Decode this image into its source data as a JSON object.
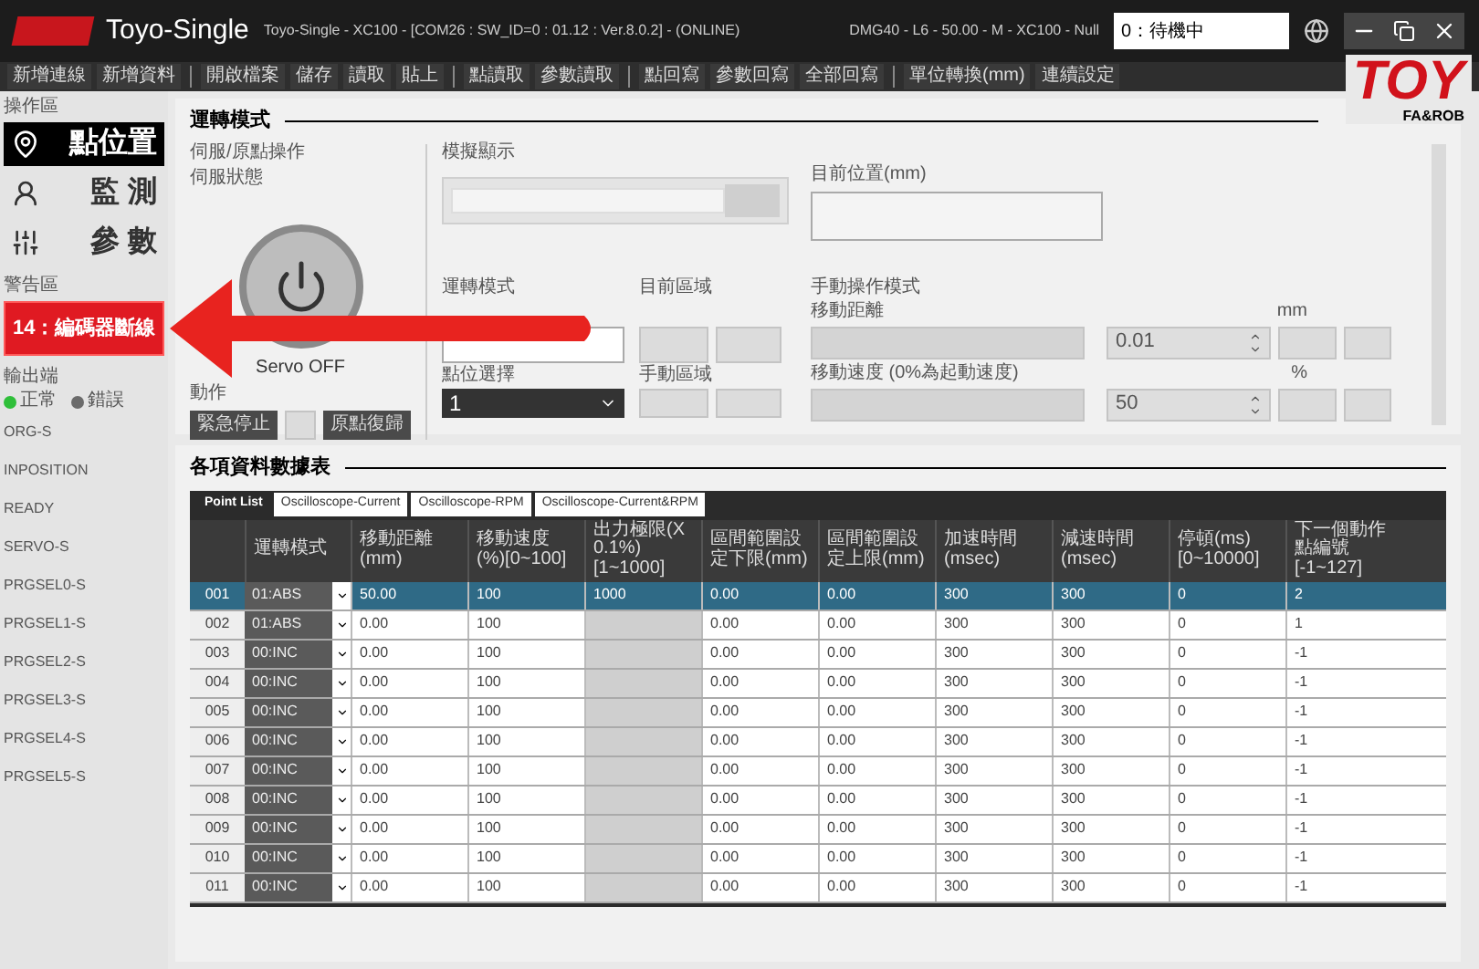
{
  "title_bar": {
    "app_name": "Toyo-Single",
    "info": "Toyo-Single - XC100 - [COM26 : SW_ID=0 : 01.12 : Ver.8.0.2] - (ONLINE)",
    "model": "DMG40 - L6 - 50.00 - M - XC100 - Null",
    "status": "0：待機中"
  },
  "toolbar": [
    [
      "新增連線",
      "新增資料"
    ],
    [
      "開啟檔案",
      "儲存",
      "讀取",
      "貼上"
    ],
    [
      "點讀取",
      "參數讀取"
    ],
    [
      "點回寫",
      "參數回寫",
      "全部回寫"
    ],
    [
      "單位轉換(mm)",
      "連續設定"
    ]
  ],
  "brand": {
    "name": "TOY",
    "tagline": "FA&ROB"
  },
  "sidebar": {
    "nav_label": "操作區",
    "nav": [
      {
        "label": "點位置",
        "selected": true
      },
      {
        "label": "監 測",
        "selected": false
      },
      {
        "label": "參 數",
        "selected": false
      }
    ],
    "alarm_label": "警告區",
    "alarm": "14：編碼器斷線",
    "io_label": "輸出端",
    "legend": [
      {
        "label": "正常",
        "color": "#2fbf3a"
      },
      {
        "label": "錯誤",
        "color": "#6b6b6b"
      }
    ],
    "signals": [
      "ORG-S",
      "INPOSITION",
      "READY",
      "SERVO-S",
      "PRGSEL0-S",
      "PRGSEL1-S",
      "PRGSEL2-S",
      "PRGSEL3-S",
      "PRGSEL4-S",
      "PRGSEL5-S"
    ]
  },
  "operation": {
    "title": "運轉模式",
    "servo_label": "伺服/原點操作",
    "servo_state_label": "伺服狀態",
    "servo_text": "Servo OFF",
    "action_label": "動作",
    "action_buttons": [
      "緊急停止",
      "原點復歸"
    ],
    "sim_label": "模擬顯示",
    "position_label": "目前位置(mm)",
    "mode_label": "運轉模式",
    "current_area_label": "目前區域",
    "point_label": "點位選擇",
    "point_value": "1",
    "manual_area_label": "手動區域",
    "manual_title": "手動操作模式",
    "distance_label": "移動距離",
    "distance_value": "0.01",
    "distance_unit": "mm",
    "speed_label": "移動速度 (0%為起動速度)",
    "speed_value": "50",
    "speed_unit": "%"
  },
  "data_table": {
    "title": "各項資料數據表",
    "tabs": [
      {
        "label": "Point List",
        "selected": true
      },
      {
        "label": "Oscilloscope-Current",
        "selected": false
      },
      {
        "label": "Oscilloscope-RPM",
        "selected": false
      },
      {
        "label": "Oscilloscope-Current&RPM",
        "selected": false
      }
    ],
    "columns": [
      "運轉模式",
      "移動距離(mm)",
      "移動速度(%)[0~100]",
      "出力極限(X 0.1%)[1~1000]",
      "區間範圍設定下限(mm)",
      "區間範圍設定上限(mm)",
      "加速時間(msec)",
      "減速時間(msec)",
      "停頓(ms)[0~10000]",
      "下一個動作點編號[-1~127]"
    ],
    "rows": [
      {
        "no": "001",
        "mode": "01:ABS",
        "distance": "50.00",
        "speed": "100",
        "force": "1000",
        "lower": "0.00",
        "upper": "0.00",
        "accel": "300",
        "decel": "300",
        "pause": "0",
        "next": "2",
        "selected": true
      },
      {
        "no": "002",
        "mode": "01:ABS",
        "distance": "0.00",
        "speed": "100",
        "lower": "0.00",
        "upper": "0.00",
        "accel": "300",
        "decel": "300",
        "pause": "0",
        "next": "1",
        "selected": false
      },
      {
        "no": "003",
        "mode": "00:INC",
        "distance": "0.00",
        "speed": "100",
        "lower": "0.00",
        "upper": "0.00",
        "accel": "300",
        "decel": "300",
        "pause": "0",
        "next": "-1",
        "selected": false
      },
      {
        "no": "004",
        "mode": "00:INC",
        "distance": "0.00",
        "speed": "100",
        "lower": "0.00",
        "upper": "0.00",
        "accel": "300",
        "decel": "300",
        "pause": "0",
        "next": "-1",
        "selected": false
      },
      {
        "no": "005",
        "mode": "00:INC",
        "distance": "0.00",
        "speed": "100",
        "lower": "0.00",
        "upper": "0.00",
        "accel": "300",
        "decel": "300",
        "pause": "0",
        "next": "-1",
        "selected": false
      },
      {
        "no": "006",
        "mode": "00:INC",
        "distance": "0.00",
        "speed": "100",
        "lower": "0.00",
        "upper": "0.00",
        "accel": "300",
        "decel": "300",
        "pause": "0",
        "next": "-1",
        "selected": false
      },
      {
        "no": "007",
        "mode": "00:INC",
        "distance": "0.00",
        "speed": "100",
        "lower": "0.00",
        "upper": "0.00",
        "accel": "300",
        "decel": "300",
        "pause": "0",
        "next": "-1",
        "selected": false
      },
      {
        "no": "008",
        "mode": "00:INC",
        "distance": "0.00",
        "speed": "100",
        "lower": "0.00",
        "upper": "0.00",
        "accel": "300",
        "decel": "300",
        "pause": "0",
        "next": "-1",
        "selected": false
      },
      {
        "no": "009",
        "mode": "00:INC",
        "distance": "0.00",
        "speed": "100",
        "lower": "0.00",
        "upper": "0.00",
        "accel": "300",
        "decel": "300",
        "pause": "0",
        "next": "-1",
        "selected": false
      },
      {
        "no": "010",
        "mode": "00:INC",
        "distance": "0.00",
        "speed": "100",
        "lower": "0.00",
        "upper": "0.00",
        "accel": "300",
        "decel": "300",
        "pause": "0",
        "next": "-1",
        "selected": false
      },
      {
        "no": "011",
        "mode": "00:INC",
        "distance": "0.00",
        "speed": "100",
        "lower": "0.00",
        "upper": "0.00",
        "accel": "300",
        "decel": "300",
        "pause": "0",
        "next": "-1",
        "selected": false
      }
    ]
  }
}
